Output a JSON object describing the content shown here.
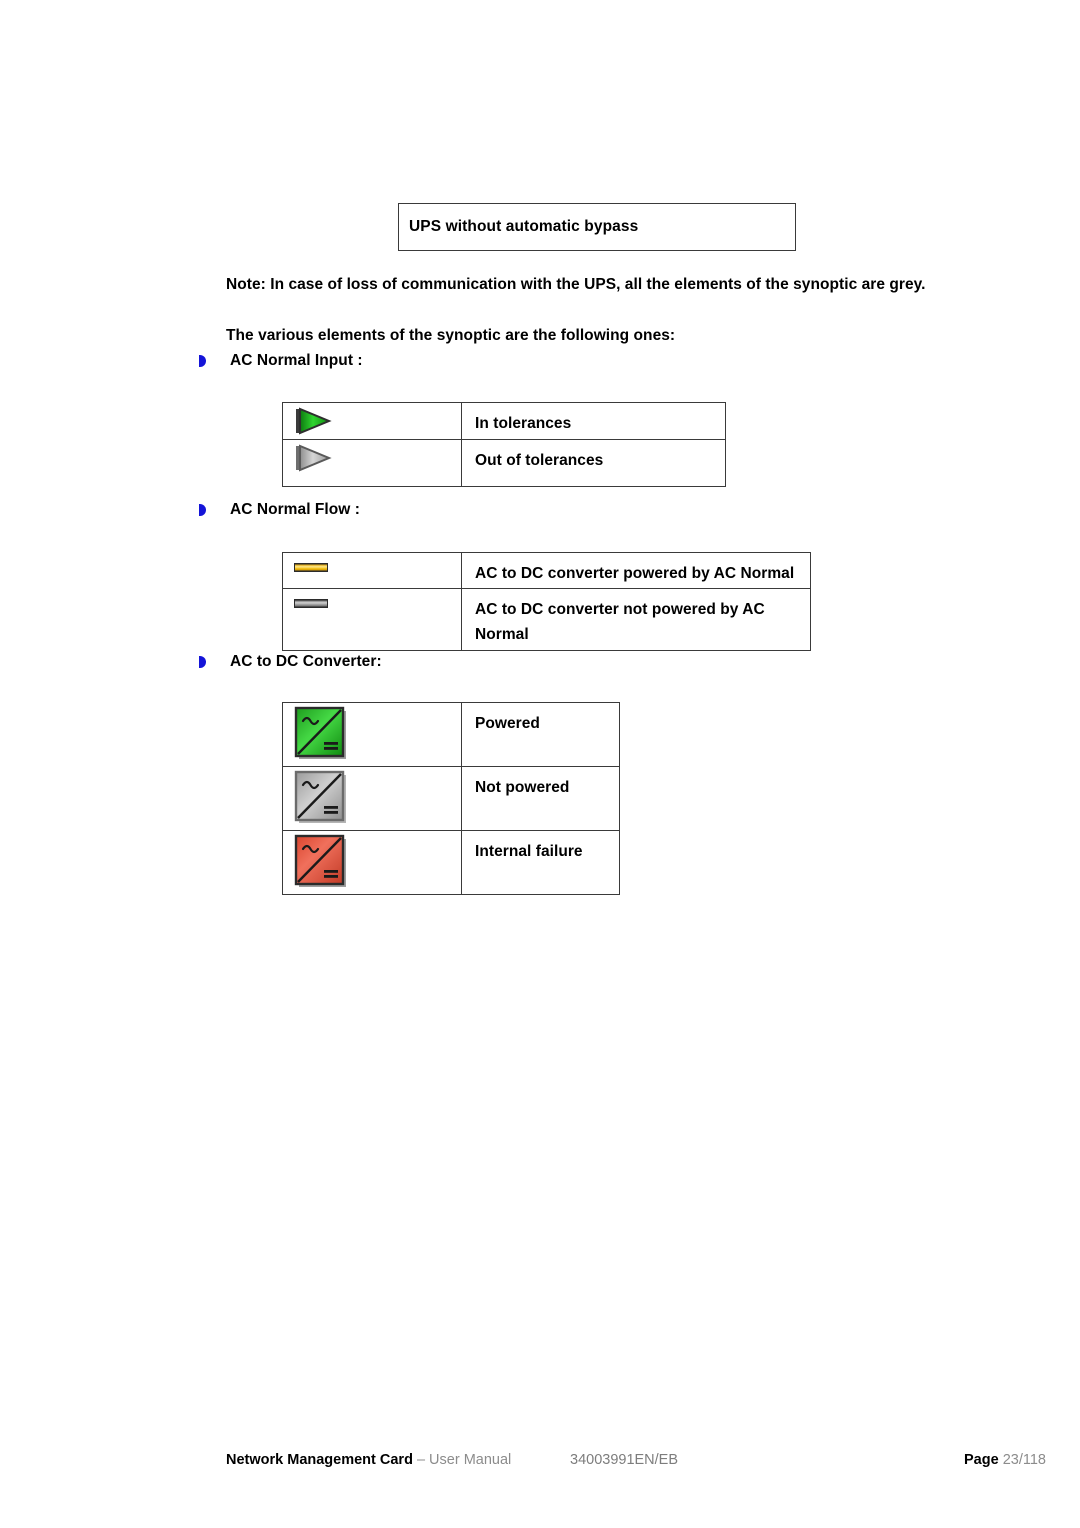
{
  "document": {
    "caption_box": {
      "text": "UPS without automatic bypass"
    },
    "note": "Note: In case of loss of communication with the UPS, all the elements of the synoptic are grey.",
    "intro": "The various elements of the synoptic are the following ones:"
  },
  "sections": [
    {
      "bullet_label": "AC Normal Input :",
      "bullet_icon": "blue-arrow-bullet-icon",
      "rows": [
        {
          "icon": "green-flag-icon",
          "label": "In tolerances"
        },
        {
          "icon": "grey-flag-icon",
          "label": "Out of tolerances"
        }
      ]
    },
    {
      "bullet_label": "AC Normal Flow :",
      "bullet_icon": "blue-arrow-bullet-icon",
      "rows": [
        {
          "icon": "yellow-flow-bar-icon",
          "label": "AC to DC converter powered by AC Normal"
        },
        {
          "icon": "grey-flow-bar-icon",
          "label": "AC to DC converter not powered by AC Normal"
        }
      ]
    },
    {
      "bullet_label": "AC to DC Converter:",
      "bullet_icon": "blue-arrow-bullet-icon",
      "rows": [
        {
          "icon": "green-converter-icon",
          "label": "Powered"
        },
        {
          "icon": "grey-converter-icon",
          "label": "Not powered"
        },
        {
          "icon": "red-converter-icon",
          "label": "Internal failure"
        }
      ]
    }
  ],
  "footer": {
    "title": "Network Management Card",
    "subtitle": "– User Manual",
    "doc_code": "34003991EN/EB",
    "page_label": "Page",
    "page_value": "23/118"
  },
  "colors": {
    "bullet_blue": "#1414d8",
    "flag_green": "#19b219",
    "flag_grey": "#a0a0a0",
    "flow_yellow": "#f5c41e",
    "flow_grey": "#8c8c8c",
    "converter_green": "#2bb52b",
    "converter_grey": "#a8a8a8",
    "converter_red": "#e8503c",
    "border": "#3a3a3a",
    "footer_grey": "#8c8c8c"
  }
}
